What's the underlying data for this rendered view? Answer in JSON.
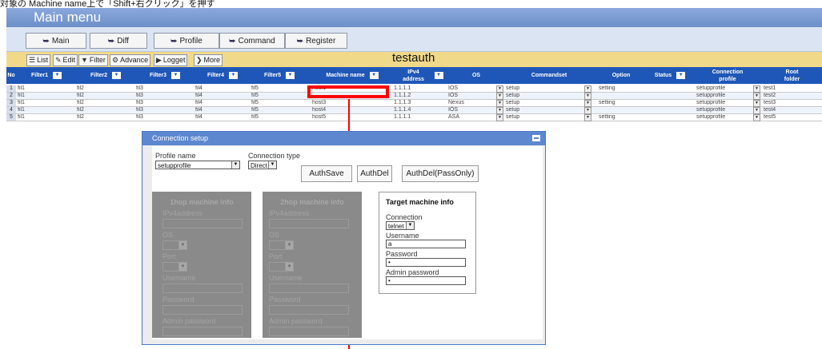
{
  "caption": "対象の Machine name上で「Shift+右クリック」を押す",
  "header": {
    "title": "Main menu"
  },
  "nav": [
    {
      "label": "Main"
    },
    {
      "label": "Diff"
    },
    {
      "label": "Profile"
    },
    {
      "label": "Command"
    },
    {
      "label": "Register"
    }
  ],
  "toolbar": {
    "list": "List",
    "edit": "Edit",
    "filter": "Filter",
    "advance": "Advance",
    "logget": "Logget",
    "more": "More"
  },
  "grid": {
    "title": "testauth",
    "headers": {
      "no": "No",
      "filter1": "Filter1",
      "filter2": "Filter2",
      "filter3": "Filter3",
      "filter4": "Filter4",
      "filter5": "Filter5",
      "machine": "Machine name",
      "ipv4": "IPv4 address",
      "os": "OS",
      "commandset": "Commandset",
      "option": "Option",
      "status": "Status",
      "connection": "Connection profile",
      "root": "Root folder"
    },
    "rows": [
      {
        "no": "1",
        "f1": "fil1",
        "f2": "fil2",
        "f3": "fil3",
        "f4": "fil4",
        "f5": "fil5",
        "machine": "host1",
        "ipv4": "1.1.1.1",
        "os": "IOS",
        "commandset": "setup",
        "option": "setting",
        "status": "",
        "connection": "setupprofile",
        "root": "test1"
      },
      {
        "no": "2",
        "f1": "fil1",
        "f2": "fil2",
        "f3": "fil3",
        "f4": "fil4",
        "f5": "fil5",
        "machine": "",
        "ipv4": "1.1.1.2",
        "os": "IOS",
        "commandset": "setup",
        "option": "",
        "status": "",
        "connection": "setupprofile",
        "root": "test2"
      },
      {
        "no": "3",
        "f1": "fil1",
        "f2": "fil2",
        "f3": "fil3",
        "f4": "fil4",
        "f5": "fil5",
        "machine": "host3",
        "ipv4": "1.1.1.3",
        "os": "Nexus",
        "commandset": "setup",
        "option": "setting",
        "status": "",
        "connection": "setupprofile",
        "root": "test3"
      },
      {
        "no": "4",
        "f1": "fil1",
        "f2": "fil2",
        "f3": "fil3",
        "f4": "fil4",
        "f5": "fil5",
        "machine": "host4",
        "ipv4": "1.1.1.4",
        "os": "IOS",
        "commandset": "setup",
        "option": "",
        "status": "",
        "connection": "setupprofile",
        "root": "test4"
      },
      {
        "no": "5",
        "f1": "fil1",
        "f2": "fil2",
        "f3": "fil3",
        "f4": "fil4",
        "f5": "fil5",
        "machine": "host5",
        "ipv4": "1.1.1.1",
        "os": "ASA",
        "commandset": "setup",
        "option": "setting",
        "status": "",
        "connection": "setupprofile",
        "root": "test5"
      }
    ]
  },
  "dialog": {
    "title": "Connection setup",
    "profile_label": "Profile name",
    "profile_value": "setupprofile",
    "conntype_label": "Connection type",
    "conntype_value": "Direct",
    "btn_authsave": "AuthSave",
    "btn_authdel": "AuthDel",
    "btn_authdel_pass": "AuthDel(PassOnly)",
    "hop1": {
      "title": "1hop machine info",
      "ipv4": "IPv4address",
      "os": "OS",
      "port": "Port",
      "username": "Username",
      "password": "Password",
      "admin": "Admin password"
    },
    "hop2": {
      "title": "2hop machine info",
      "ipv4": "IPv4address",
      "os": "OS",
      "port": "Port",
      "username": "Username",
      "password": "Password",
      "admin": "Admin password"
    },
    "target": {
      "title": "Target machine info",
      "connection_label": "Connection",
      "connection_value": "telnet",
      "username_label": "Username",
      "username_value": "a",
      "password_label": "Password",
      "password_value": "•",
      "admin_label": "Admin password",
      "admin_value": "•"
    }
  },
  "colors": {
    "accent": "#ff0000",
    "header": "#1f57b8",
    "toolbar": "#f1d98a"
  }
}
